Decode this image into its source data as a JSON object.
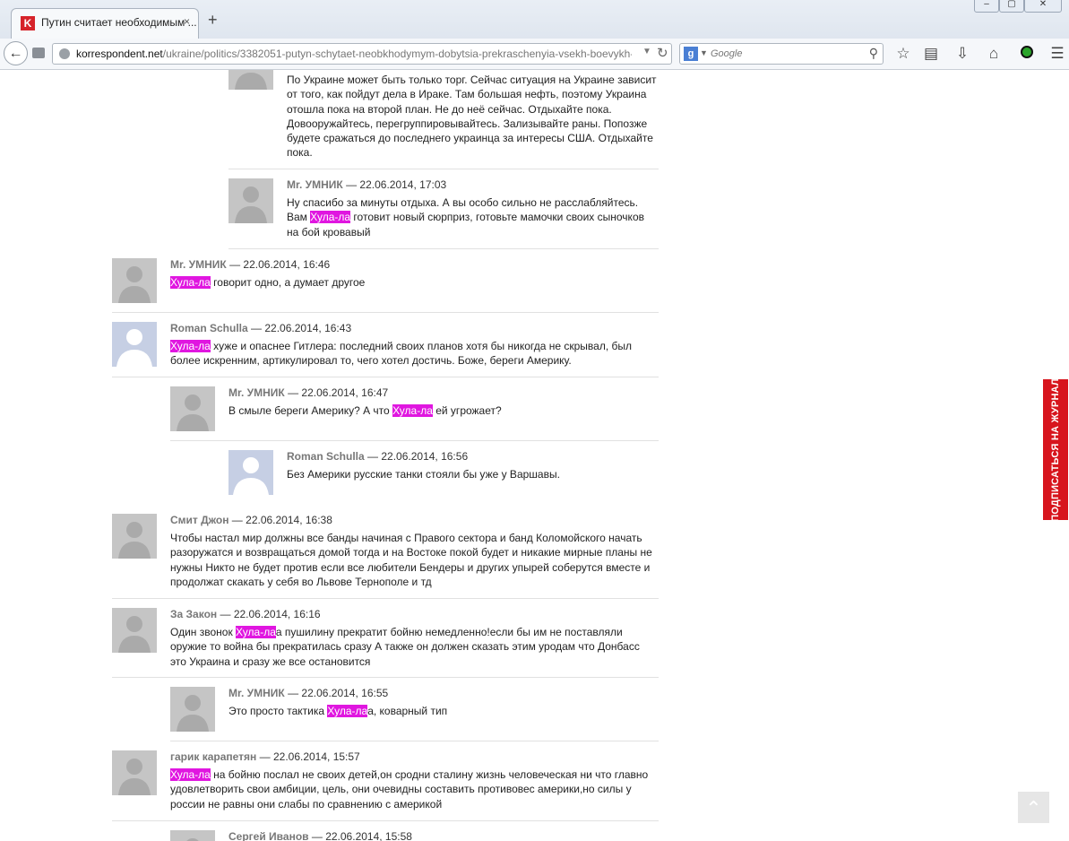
{
  "browser": {
    "tab_title": "Путин считает необходимым ...",
    "tab_close": "×",
    "new_tab": "+",
    "favicon_letter": "K",
    "url_domain": "korrespondent.net",
    "url_path": "/ukraine/politics/3382051-putyn-schytaet-neobkhodymym-dobytsia-prekraschenyia-vsekh-boevykh-deis",
    "search_engine": "Google",
    "search_placeholder": "Google"
  },
  "sidebar": {
    "subscribe_label": "ПОДПИСАТЬСЯ НА ЖУРНАЛ"
  },
  "comments": [
    {
      "indent": 2,
      "avatar": "gray",
      "author": "",
      "datetime": "",
      "text": "По Украине может быть только торг. Сейчас ситуация на Украине зависит от того, как пойдут дела в Ираке. Там большая нефть, поэтому Украина отошла пока на второй план. Не до неё сейчас. Отдыхайте пока. Довооружайтесь, перегруппировывайтесь. Зализывайте раны. Попозже будете сражаться до последнего украинца за интересы США. Отдыхайте пока."
    },
    {
      "indent": 2,
      "avatar": "gray",
      "author": "Mr. УМНИК",
      "datetime": "22.06.2014, 17:03",
      "text_before": "Ну спасибо за минуты отдыха. А вы особо сильно не расслабляйтесь. Вам ",
      "highlight": "Хула-ла",
      "text_after": " готовит новый сюрприз, готовьте мамочки своих сыночков на бой кровавый"
    },
    {
      "indent": 0,
      "avatar": "gray",
      "author": "Mr. УМНИК",
      "datetime": "22.06.2014, 16:46",
      "text_before": "",
      "highlight": "Хула-ла",
      "text_after": " говорит одно, а думает другое"
    },
    {
      "indent": 0,
      "avatar": "fb",
      "author": "Roman Schulla",
      "datetime": "22.06.2014, 16:43",
      "text_before": "",
      "highlight": "Хула-ла",
      "text_after": " хуже и опаснее Гитлера: последний своих планов хотя бы никогда не скрывал, был более искренним, артикулировал то, чего хотел достичь. Боже, береги Америку."
    },
    {
      "indent": 1,
      "avatar": "gray",
      "author": "Mr. УМНИК",
      "datetime": "22.06.2014, 16:47",
      "text_before": "В смыле береги Америку? А что ",
      "highlight": "Хула-ла",
      "text_after": " ей угрожает?"
    },
    {
      "indent": 2,
      "avatar": "fb",
      "author": "Roman Schulla",
      "datetime": "22.06.2014, 16:56",
      "text_before": "Без Америки русские танки стояли бы уже у Варшавы.",
      "highlight": "",
      "text_after": ""
    },
    {
      "indent": 0,
      "avatar": "gray",
      "author": "Смит Джон",
      "datetime": "22.06.2014, 16:38",
      "text_before": "Чтобы настал мир должны все банды начиная с Правого сектора и банд Коломойского начать разоружатся и возвращаться домой тогда и на Востоке покой будет и никакие мирные планы не нужны Никто не будет против если все любители Бендеры и других упырей соберутся вместе и продолжат скакать у себя во Львове Тернополе и тд",
      "highlight": "",
      "text_after": ""
    },
    {
      "indent": 0,
      "avatar": "gray",
      "author": "За Закон",
      "datetime": "22.06.2014, 16:16",
      "text_before": "Один звонок ",
      "highlight": "Хула-ла",
      "text_after": "а пушилину прекратит бойню немедленно!если бы им не поставляли оружие то война бы прекратилась сразу А также он должен сказать этим уродам что Донбасс это Украина и сразу же все остановится"
    },
    {
      "indent": 1,
      "avatar": "gray",
      "author": "Mr. УМНИК",
      "datetime": "22.06.2014, 16:55",
      "text_before": "Это просто тактика ",
      "highlight": "Хула-ла",
      "text_after": "а, коварный тип"
    },
    {
      "indent": 0,
      "avatar": "gray",
      "author": "гарик карапетян",
      "datetime": "22.06.2014, 15:57",
      "text_before": "",
      "highlight": "Хула-ла",
      "text_after": " на бойню послал не своих детей,он сродни сталину жизнь человеческая ни что главно удовлетворить свои амбиции, цель, они очевидны составить противовес америки,но силы у россии не равны они слабы по сравнению с америкой"
    },
    {
      "indent": 1,
      "avatar": "gray",
      "author": "Сергей Иванов",
      "datetime": "22.06.2014, 15:58",
      "text_before": "",
      "highlight": "",
      "text_after": ""
    }
  ]
}
